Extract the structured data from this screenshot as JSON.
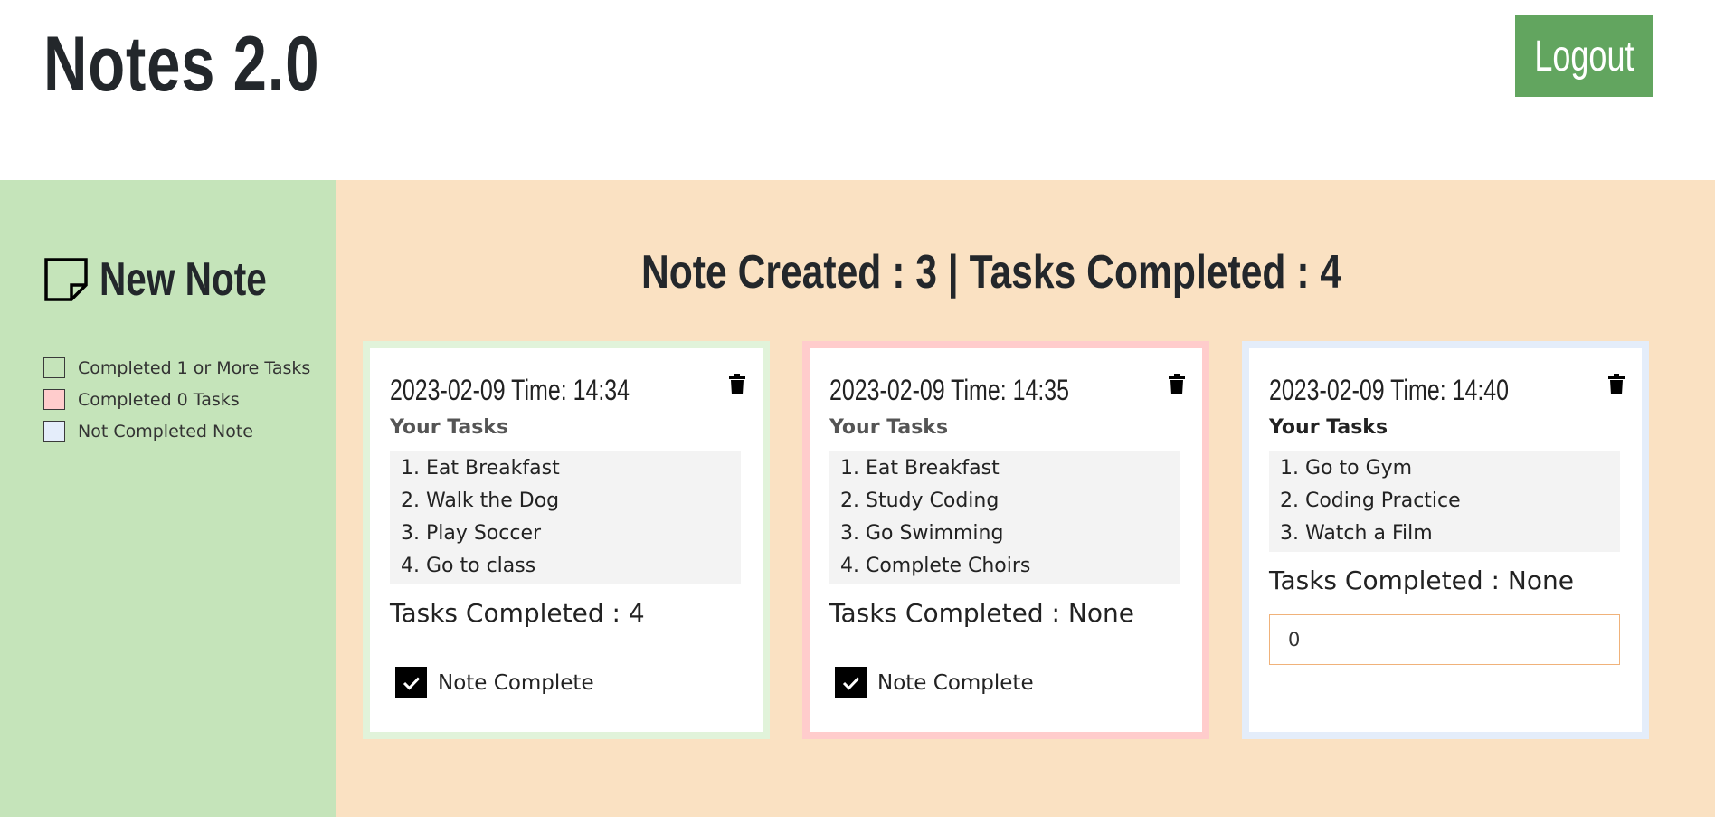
{
  "header": {
    "title": "Notes 2.0",
    "logout_label": "Logout"
  },
  "sidebar": {
    "new_note_label": "New Note",
    "legend": [
      {
        "label": "Completed 1 or More Tasks",
        "color": "#c5e4ba"
      },
      {
        "label": "Completed 0 Tasks",
        "color": "#ffcccc"
      },
      {
        "label": "Not Completed Note",
        "color": "#e4edfa"
      }
    ]
  },
  "main": {
    "summary": "Note Created : 3 | Tasks Completed : 4",
    "notes": [
      {
        "date": "2023-02-09 Time: 14:34",
        "tasks_label": "Your Tasks",
        "tasks": [
          "1. Eat Breakfast",
          "2. Walk the Dog",
          "3. Play Soccer",
          "4. Go to class"
        ],
        "completed_text": "Tasks Completed : 4",
        "complete_label": "Note Complete",
        "border_color": "#e1f3da"
      },
      {
        "date": "2023-02-09 Time: 14:35",
        "tasks_label": "Your Tasks",
        "tasks": [
          "1. Eat Breakfast",
          "2. Study Coding",
          "3. Go Swimming",
          "4. Complete Choirs"
        ],
        "completed_text": "Tasks Completed : None",
        "complete_label": "Note Complete",
        "border_color": "#ffcccc"
      },
      {
        "date": "2023-02-09 Time: 14:40",
        "tasks_label": "Your Tasks",
        "tasks": [
          "1. Go to Gym",
          "2. Coding Practice",
          "3. Watch a Film"
        ],
        "completed_text": "Tasks Completed : None",
        "input_value": "0",
        "border_color": "#e4edfa"
      }
    ]
  },
  "colors": {
    "logout_button": "#62a55f",
    "sidebar_bg": "#c5e4ba",
    "main_bg": "#fae1c2"
  }
}
